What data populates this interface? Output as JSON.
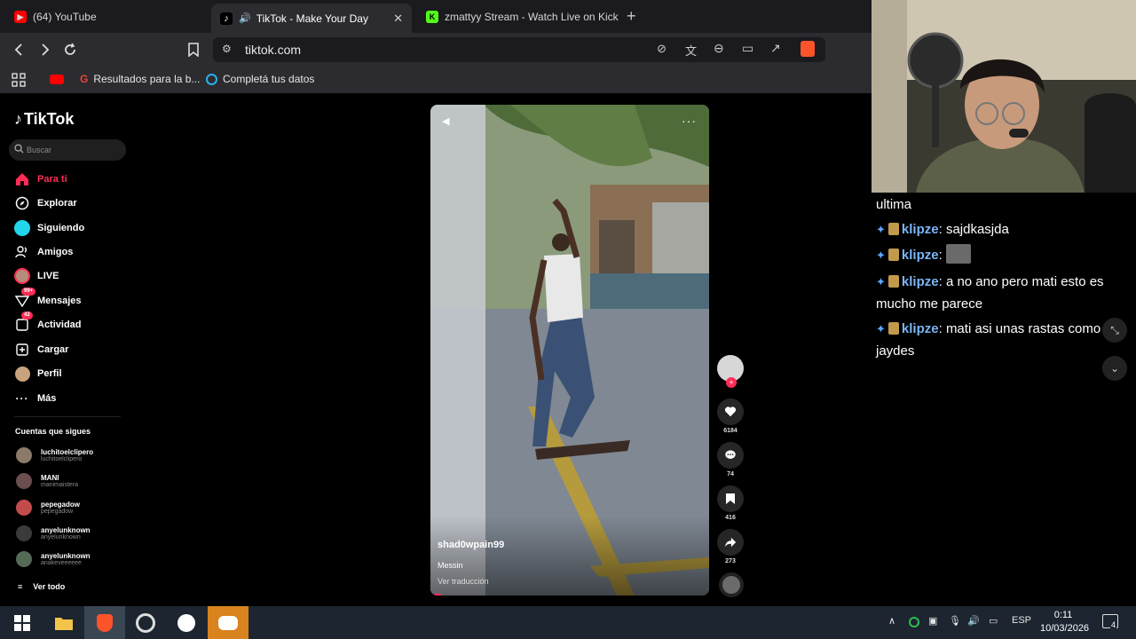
{
  "browser": {
    "tabs": [
      {
        "label": "(64) YouTube",
        "icon": "youtube-icon"
      },
      {
        "label": "TikTok - Make Your Day",
        "icon": "tiktok-icon",
        "active": true
      },
      {
        "label": "zmattyy Stream - Watch Live on Kick",
        "icon": "kick-icon"
      }
    ],
    "url": "tiktok.com",
    "bookmarks": {
      "item1": "Resultados para la b...",
      "item2": "Completá tus datos"
    }
  },
  "tiktok": {
    "logo": "TikTok",
    "search_placeholder": "Buscar",
    "nav": [
      {
        "label": "Para ti",
        "icon": "home-icon"
      },
      {
        "label": "Explorar",
        "icon": "compass-icon"
      },
      {
        "label": "Siguiendo",
        "icon": "following-icon"
      },
      {
        "label": "Amigos",
        "icon": "friends-icon"
      },
      {
        "label": "LIVE",
        "icon": "live-icon"
      },
      {
        "label": "Mensajes",
        "icon": "messages-icon",
        "badge": "99+"
      },
      {
        "label": "Actividad",
        "icon": "activity-icon",
        "badge": "42"
      },
      {
        "label": "Cargar",
        "icon": "upload-icon"
      },
      {
        "label": "Perfil",
        "icon": "profile-icon"
      },
      {
        "label": "Más",
        "icon": "more-icon"
      }
    ],
    "following_title": "Cuentas que sigues",
    "accounts": [
      {
        "name": "luchitoelclipero",
        "handle": "luchitoelclipero"
      },
      {
        "name": "MANI",
        "handle": "manimaistera"
      },
      {
        "name": "pepegadow",
        "handle": "pepegadow"
      },
      {
        "name": "anyelunknown",
        "handle": "anyelunknown"
      },
      {
        "name": "anyelunknown",
        "handle": "anakeveeeeee"
      }
    ],
    "see_all": "Ver todo",
    "video": {
      "username": "shad0wpain99",
      "caption": "Messin",
      "translate": "Ver traducción",
      "progress": 0.04
    },
    "actions": {
      "likes": "6184",
      "comments": "74",
      "saves": "416",
      "shares": "273"
    }
  },
  "chat": {
    "line0": "ultima",
    "messages": [
      {
        "user": "klipze",
        "text": "sajdkasjda"
      },
      {
        "user": "klipze",
        "text": ""
      },
      {
        "user": "klipze",
        "text": "a no ano pero mati esto es mucho me parece"
      },
      {
        "user": "klipze",
        "text": "mati asi unas rastas como el jaydes"
      }
    ]
  },
  "taskbar": {
    "lang": "ESP",
    "time": "0:11",
    "date": "10/03/2026",
    "notif_count": "4"
  },
  "colors": {
    "accent": "#fe2c55",
    "chat_user": "#7ab5f5",
    "browser_bg": "#2c2c30"
  }
}
